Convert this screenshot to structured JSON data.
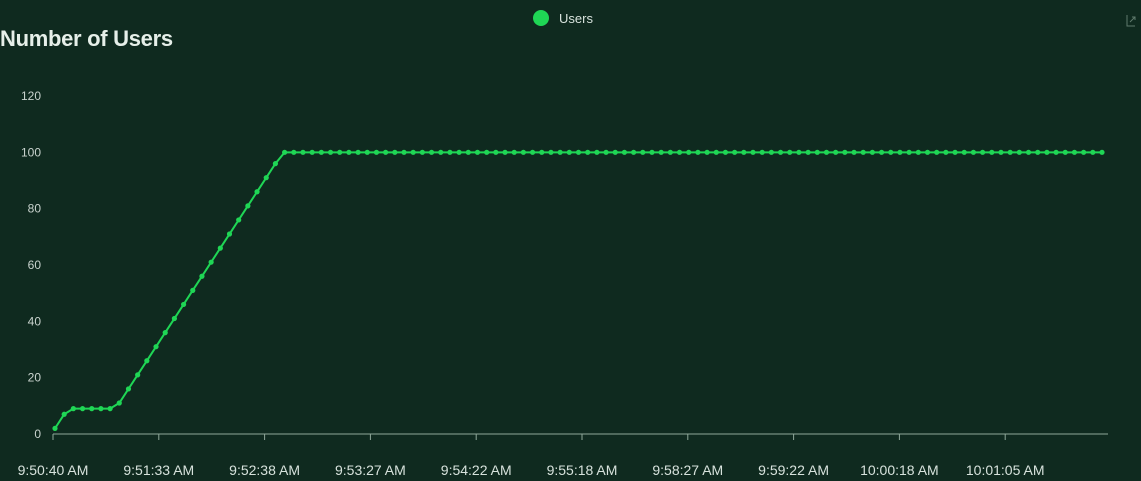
{
  "chart_data": {
    "type": "line",
    "title": "Number of Users",
    "xlabel": "",
    "ylabel": "",
    "ylim": [
      0,
      120
    ],
    "y_ticks": [
      0,
      20,
      40,
      60,
      80,
      100,
      120
    ],
    "x_tick_labels": [
      "9:50:40 AM",
      "9:51:33 AM",
      "9:52:38 AM",
      "9:53:27 AM",
      "9:54:22 AM",
      "9:55:18 AM",
      "9:58:27 AM",
      "9:59:22 AM",
      "10:00:18 AM",
      "10:01:05 AM"
    ],
    "grid": false,
    "legend_position": "top-center",
    "series": [
      {
        "name": "Users",
        "color": "#1fd655",
        "marker": "circle",
        "values": [
          2,
          7,
          9,
          9,
          9,
          9,
          9,
          11,
          16,
          21,
          26,
          31,
          36,
          41,
          46,
          51,
          56,
          61,
          66,
          71,
          76,
          81,
          86,
          91,
          96,
          100,
          100,
          100,
          100,
          100,
          100,
          100,
          100,
          100,
          100,
          100,
          100,
          100,
          100,
          100,
          100,
          100,
          100,
          100,
          100,
          100,
          100,
          100,
          100,
          100,
          100,
          100,
          100,
          100,
          100,
          100,
          100,
          100,
          100,
          100,
          100,
          100,
          100,
          100,
          100,
          100,
          100,
          100,
          100,
          100,
          100,
          100,
          100,
          100,
          100,
          100,
          100,
          100,
          100,
          100,
          100,
          100,
          100,
          100,
          100,
          100,
          100,
          100,
          100,
          100,
          100,
          100,
          100,
          100,
          100,
          100,
          100,
          100,
          100,
          100,
          100,
          100,
          100,
          100,
          100,
          100,
          100,
          100,
          100,
          100,
          100,
          100,
          100,
          100,
          100
        ]
      }
    ]
  },
  "colors": {
    "background": "#0f2a1f",
    "axis": "#8fa89a",
    "series": "#1fd655"
  },
  "icons": {
    "corner": "export-icon"
  }
}
